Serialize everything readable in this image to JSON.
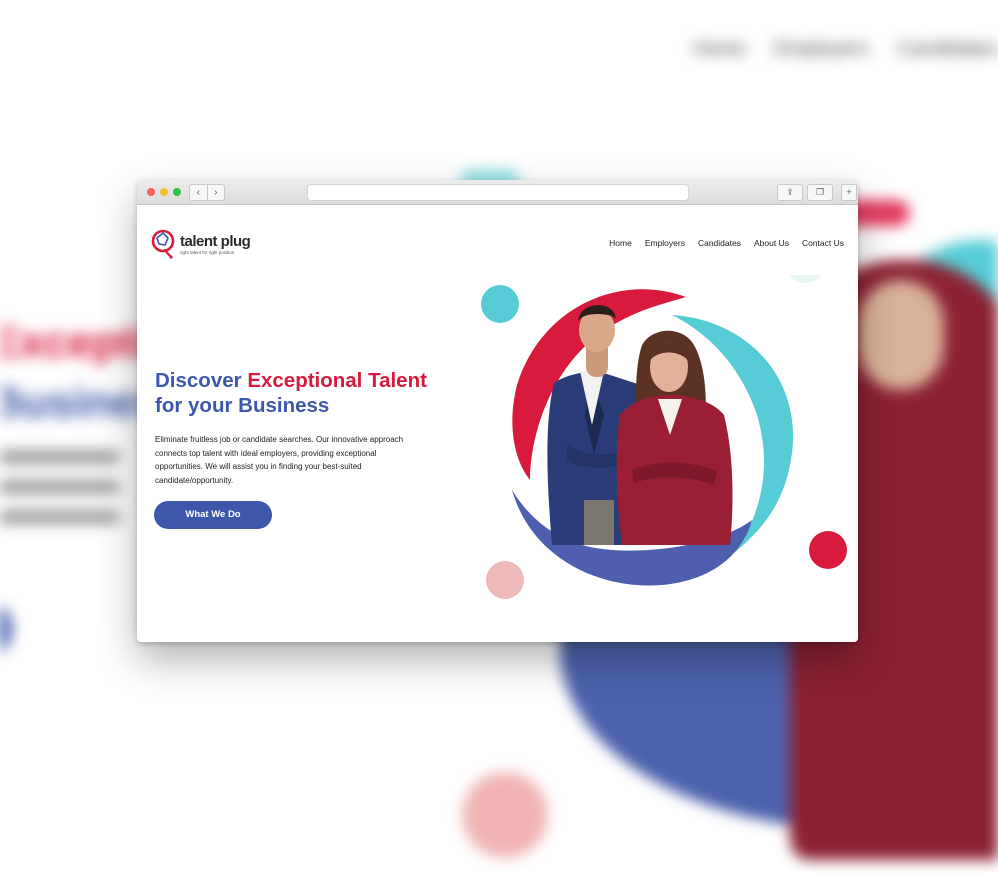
{
  "background": {
    "nav_items": [
      "Home",
      "Employers",
      "Candidates"
    ],
    "headline_1": "Exceptional",
    "headline_2": "Business"
  },
  "browser": {
    "back_icon": "chevron-left-icon",
    "forward_icon": "chevron-right-icon",
    "share_icon": "share-icon",
    "tabs_icon": "tabs-icon",
    "new_tab_icon": "plus-icon"
  },
  "logo": {
    "name": "talent plug",
    "tagline": "right talent for right position"
  },
  "nav": {
    "home": "Home",
    "employers": "Employers",
    "candidates": "Candidates",
    "about": "About Us",
    "contact": "Contact Us"
  },
  "hero": {
    "title_part1": "Discover ",
    "title_accent": "Exceptional Talent",
    "title_line2": "for your Business",
    "description": "Eliminate fruitless job or candidate searches. Our innovative approach connects top talent with ideal employers, providing exceptional opportunities. We will assist you in finding your best-suited candidate/opportunity.",
    "cta_label": "What We Do"
  },
  "colors": {
    "brand_blue": "#3d58ab",
    "brand_red": "#d81b3c",
    "accent_teal": "#56cdd6",
    "accent_pink": "#f0b9b9"
  }
}
